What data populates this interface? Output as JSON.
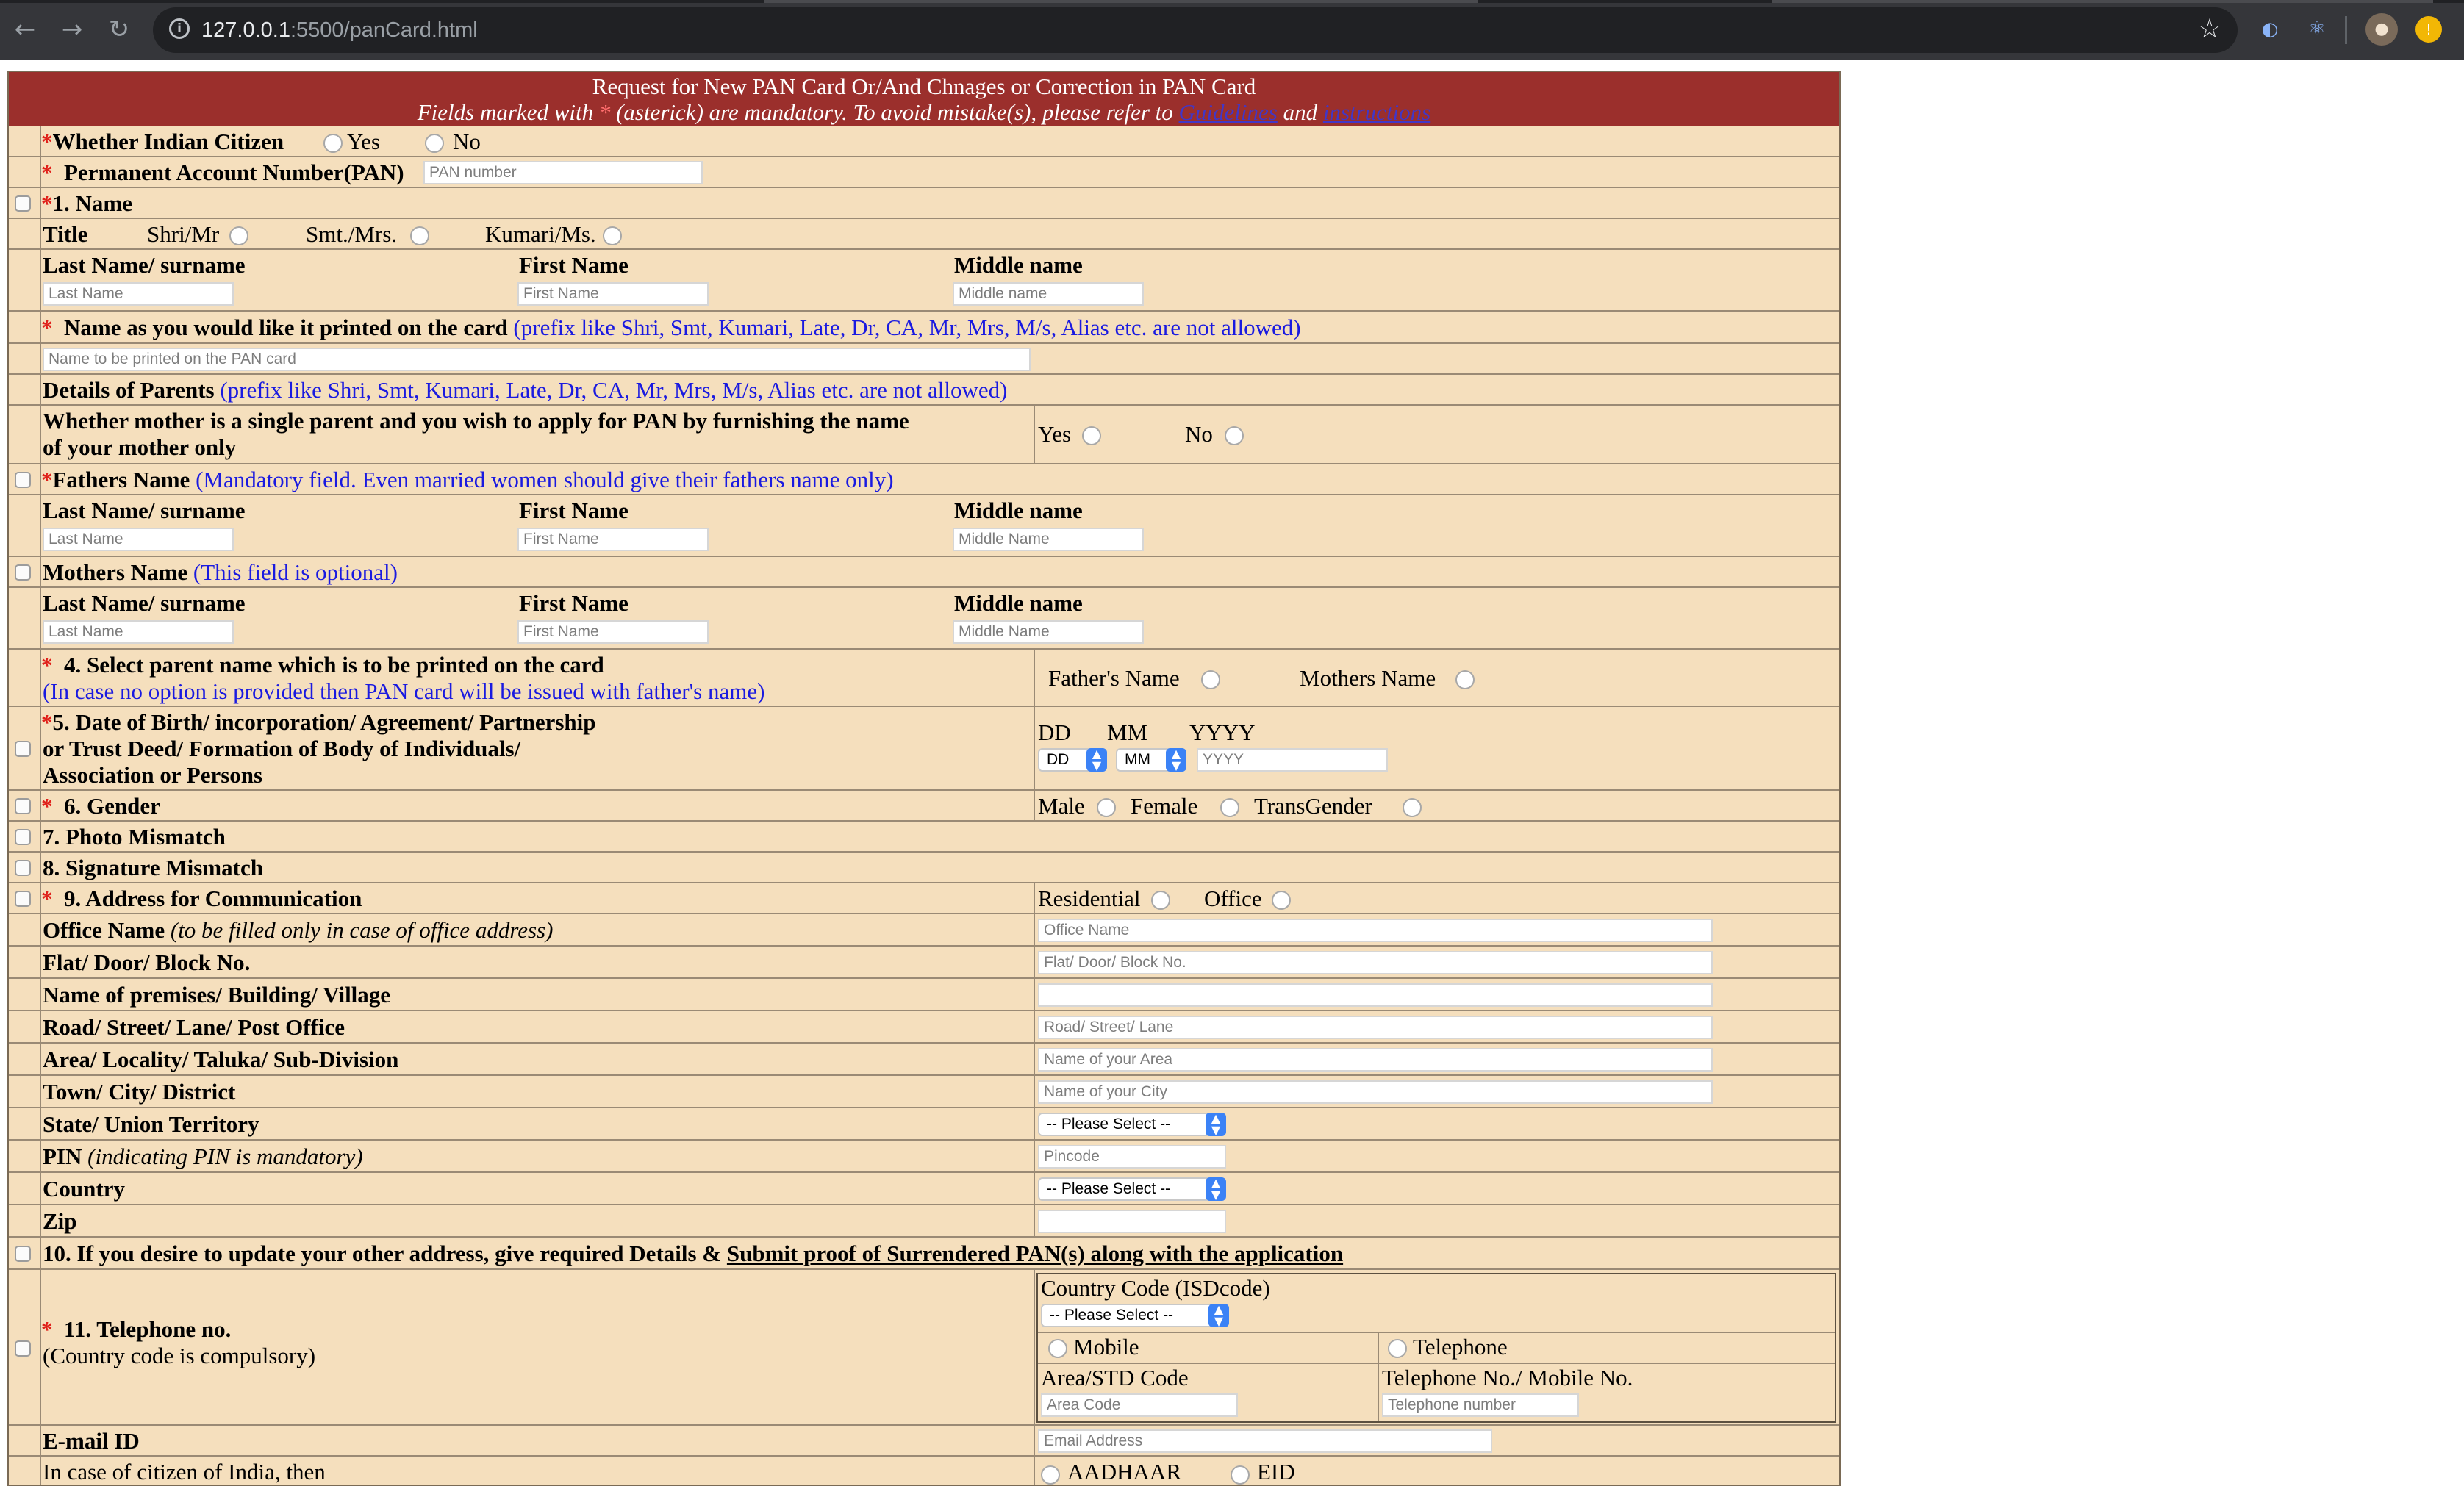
{
  "browser": {
    "url_host": "127.0.0.1",
    "url_path": ":5500/panCard.html",
    "back_icon": "back-arrow-icon",
    "forward_icon": "forward-arrow-icon",
    "reload_icon": "reload-icon",
    "bookmark_icon": "star-icon"
  },
  "header": {
    "line1": "Request for New PAN Card Or/And Chnages or Correction in PAN Card",
    "line2_a": "Fields marked with",
    "line2_b": "(asterick) are mandatory. To avoid mistake(s), please refer to",
    "guidelines": "Guidelines",
    "and": "and",
    "instructions": "instructions"
  },
  "colors": {
    "header_bg": "#9b2f2c",
    "form_bg": "#f5dfbd",
    "required": "#e0201a",
    "hint": "#1a1ae0"
  },
  "citizen": {
    "label": "Whether Indian Citizen",
    "yes": "Yes",
    "no": "No"
  },
  "pan": {
    "label": "Permanent Account Number(PAN)",
    "placeholder": "PAN number"
  },
  "name_section": {
    "label": "1. Name",
    "title_label": "Title",
    "title_opts": [
      "Shri/Mr",
      "Smt./Mrs.",
      "Kumari/Ms."
    ],
    "last": "Last Name/ surname",
    "first": "First Name",
    "middle": "Middle name",
    "ph_last": "Last Name",
    "ph_first": "First Name",
    "ph_middle": "Middle name"
  },
  "printed": {
    "label": "Name as you would like it printed on the card",
    "hint": "(prefix like Shri, Smt, Kumari, Late, Dr, CA, Mr, Mrs, M/s, Alias etc. are not allowed)",
    "placeholder": "Name to be printed on the PAN card"
  },
  "parents": {
    "label": "Details of Parents",
    "hint": "(prefix like Shri, Smt, Kumari, Late, Dr, CA, Mr, Mrs, M/s, Alias etc. are not allowed)"
  },
  "single_parent": {
    "line1": "Whether mother is a single parent and you wish to apply for PAN by furnishing the name",
    "line2": "of your mother only",
    "yes": "Yes",
    "no": "No"
  },
  "father": {
    "label": "Fathers Name",
    "hint": "(Mandatory field. Even married women should give their fathers name only)",
    "last": "Last Name/ surname",
    "first": "First Name",
    "middle": "Middle name",
    "ph_last": "Last Name",
    "ph_first": "First Name",
    "ph_middle": "Middle Name"
  },
  "mother": {
    "label": "Mothers Name",
    "hint": "(This field is optional)",
    "last": "Last Name/ surname",
    "first": "First Name",
    "middle": "Middle name",
    "ph_last": "Last Name",
    "ph_first": "First Name",
    "ph_middle": "Middle Name"
  },
  "select_parent": {
    "label": "4. Select parent name which is to be printed on the card",
    "hint": "(In case no option is provided then PAN card will be issued with father's name)",
    "father": "Father's Name",
    "mother": "Mothers Name"
  },
  "dob": {
    "line1": "5. Date of Birth/ incorporation/ Agreement/ Partnership",
    "line2": "or Trust Deed/ Formation of Body of Individuals/",
    "line3": "Association or Persons",
    "dd": "DD",
    "mm": "MM",
    "yyyy": "YYYY",
    "dd_select": "DD",
    "mm_select": "MM",
    "yyyy_placeholder": "YYYY"
  },
  "gender": {
    "label": "6. Gender",
    "male": "Male",
    "female": "Female",
    "trans": "TransGender"
  },
  "photo": {
    "label": "7. Photo Mismatch"
  },
  "signature": {
    "label": "8. Signature Mismatch"
  },
  "address": {
    "label": "9. Address for Communication",
    "residential": "Residential",
    "office": "Office",
    "office_name": "Office Name",
    "office_name_hint": "(to be filled only in case of office address)",
    "ph_office": "Office Name",
    "flat": "Flat/ Door/ Block No.",
    "ph_flat": "Flat/ Door/ Block No.",
    "premises": "Name of premises/ Building/ Village",
    "ph_premises": "",
    "road": "Road/ Street/ Lane/ Post Office",
    "ph_road": "Road/ Street/ Lane",
    "area": "Area/ Locality/ Taluka/ Sub-Division",
    "ph_area": "Name of your Area",
    "town": "Town/ City/ District",
    "ph_town": "Name of your City",
    "state": "State/ Union Territory",
    "state_select": "-- Please Select --",
    "pin": "PIN",
    "pin_hint": "(indicating PIN is mandatory)",
    "ph_pin": "Pincode",
    "country": "Country",
    "country_select": "-- Please Select --",
    "zip": "Zip",
    "ph_zip": ""
  },
  "other_address": {
    "label_a": "10. If you desire to update your other address, give required Details &",
    "label_b": "Submit proof of Surrendered PAN(s) along with the application"
  },
  "telephone": {
    "label": "11. Telephone no.",
    "hint": "(Country code is compulsory)",
    "country_code": "Country Code (ISDcode)",
    "code_select": "-- Please Select --",
    "mobile": "Mobile",
    "telephone": "Telephone",
    "area_std": "Area/STD Code",
    "tel_no": "Telephone No./ Mobile No.",
    "ph_area": "Area Code",
    "ph_tel": "Telephone number"
  },
  "email": {
    "label": "E-mail ID",
    "placeholder": "Email Address"
  },
  "india": {
    "label": "In case of citizen of India, then",
    "aadhaar": "AADHAAR",
    "eid": "EID"
  }
}
